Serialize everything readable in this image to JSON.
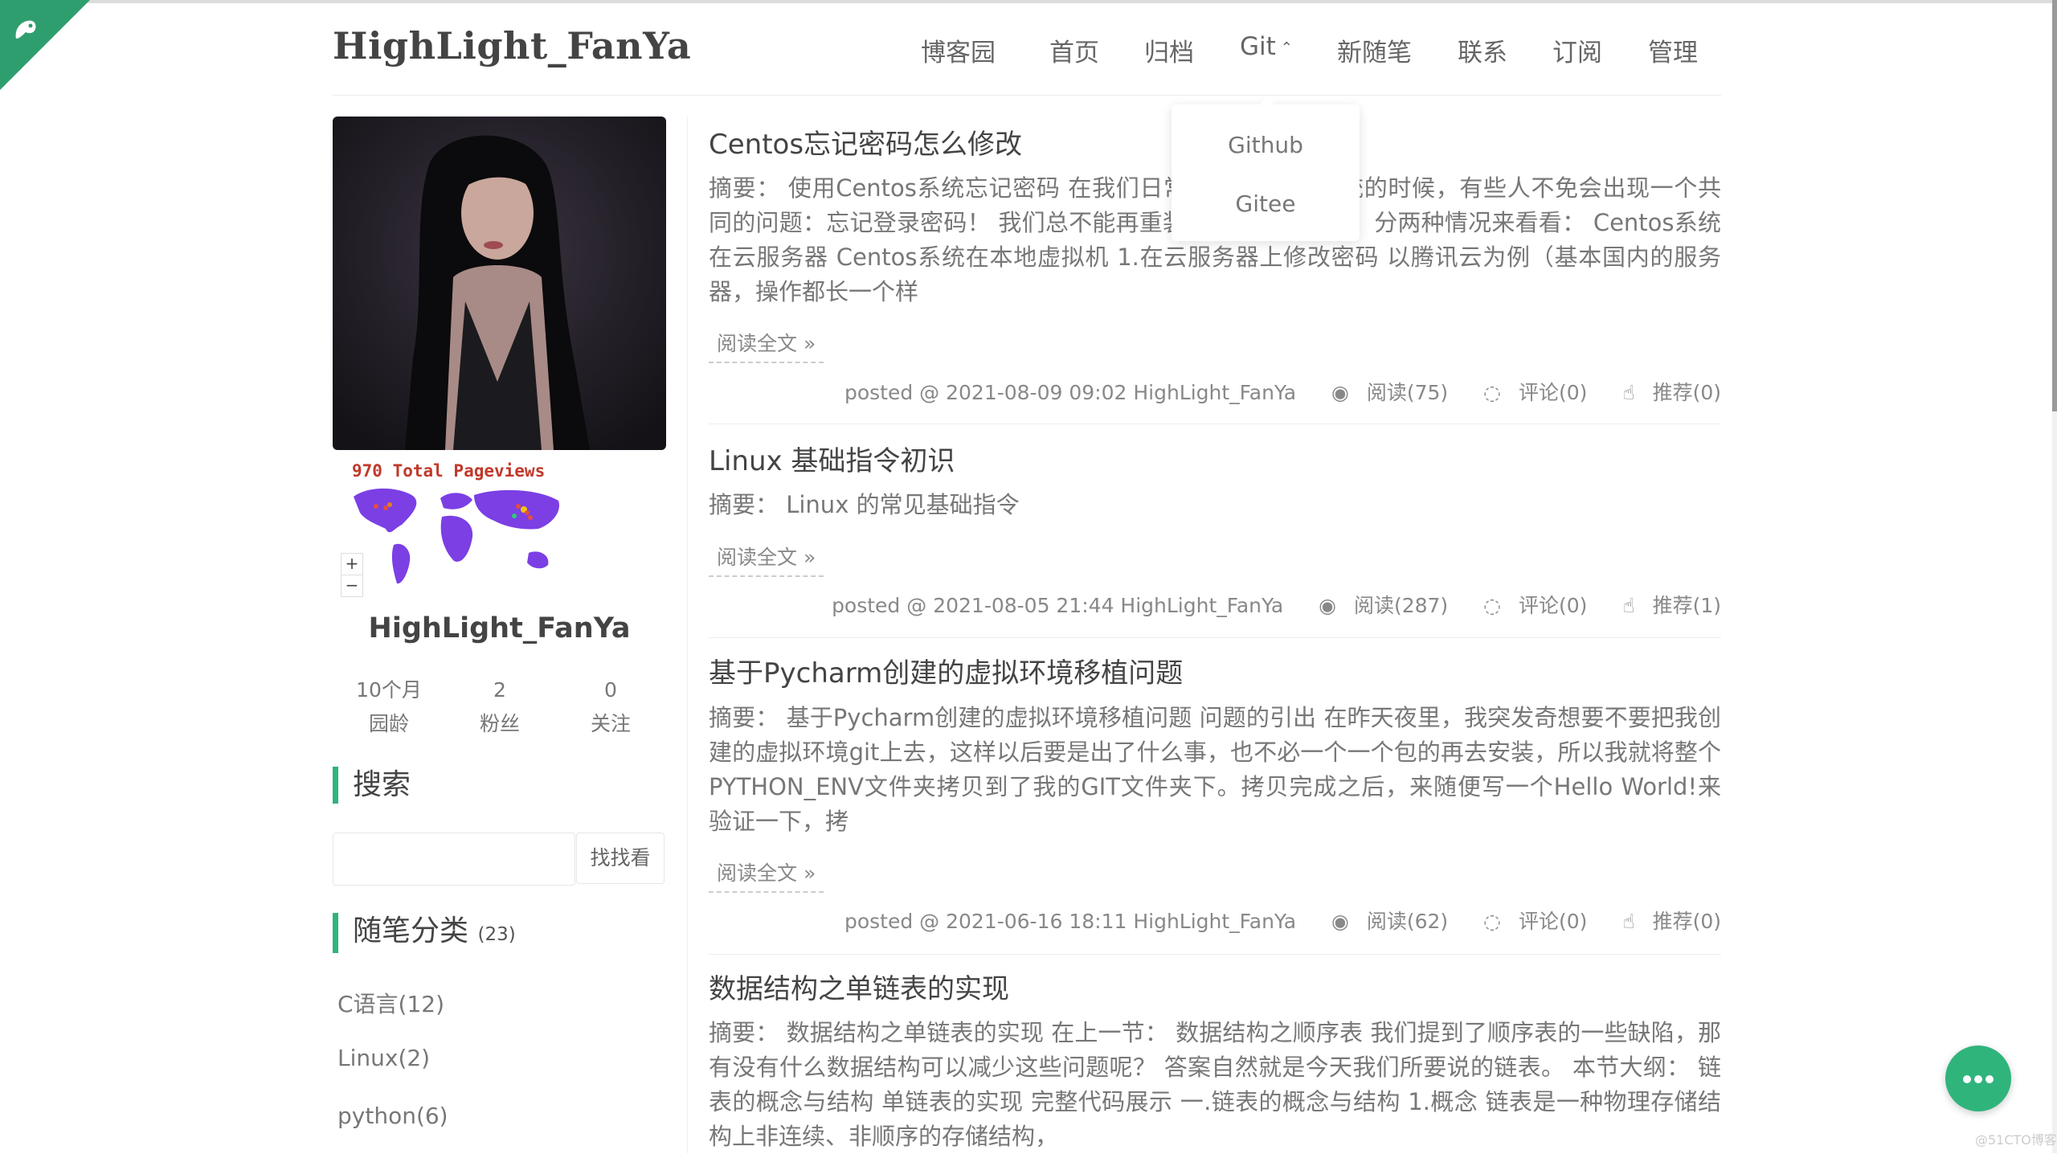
{
  "site": {
    "title": "HighLight_FanYa"
  },
  "nav": {
    "items": [
      "博客园",
      "首页",
      "归档",
      "Git",
      "新随笔",
      "联系",
      "订阅",
      "管理"
    ],
    "dropdown": [
      "Github",
      "Gitee"
    ]
  },
  "profile": {
    "pageviews": "970 Total Pageviews",
    "map_zoom_in": "+",
    "map_zoom_out": "−",
    "name": "HighLight_FanYa",
    "stats": [
      {
        "value": "10个月",
        "label": "园龄"
      },
      {
        "value": "2",
        "label": "粉丝"
      },
      {
        "value": "0",
        "label": "关注"
      }
    ]
  },
  "search": {
    "heading": "搜索",
    "button": "找找看",
    "placeholder": ""
  },
  "categories": {
    "heading": "随笔分类",
    "count": "(23)",
    "items": [
      "C语言(12)",
      "Linux(2)",
      "python(6)"
    ]
  },
  "posts": [
    {
      "title": "Centos忘记密码怎么修改",
      "summary": "摘要： 使用Centos系统忘记密码 在我们日常使用Centos系统的时候，有些人不免会出现一个共同的问题：忘记登录密码！ 我们总不能再重装一遍吧！不要慌，分两种情况来看看： Centos系统在云服务器 Centos系统在本地虚拟机 1.在云服务器上修改密码 以腾讯云为例（基本国内的服务器，操作都长一个样",
      "read_more": "阅读全文 »",
      "posted": "posted @ 2021-08-09 09:02 HighLight_FanYa",
      "views": "阅读(75)",
      "comments": "评论(0)",
      "likes": "推荐(0)"
    },
    {
      "title": "Linux 基础指令初识",
      "summary": "摘要： Linux 的常见基础指令",
      "read_more": "阅读全文 »",
      "posted": "posted @ 2021-08-05 21:44 HighLight_FanYa",
      "views": "阅读(287)",
      "comments": "评论(0)",
      "likes": "推荐(1)"
    },
    {
      "title": "基于Pycharm创建的虚拟环境移植问题",
      "summary": "摘要： 基于Pycharm创建的虚拟环境移植问题 问题的引出 在昨天夜里，我突发奇想要不要把我创建的虚拟环境git上去，这样以后要是出了什么事，也不必一个一个包的再去安装，所以我就将整个PYTHON_ENV文件夹拷贝到了我的GIT文件夹下。拷贝完成之后，来随便写一个Hello World!来验证一下，拷",
      "read_more": "阅读全文 »",
      "posted": "posted @ 2021-06-16 18:11 HighLight_FanYa",
      "views": "阅读(62)",
      "comments": "评论(0)",
      "likes": "推荐(0)"
    },
    {
      "title": "数据结构之单链表的实现",
      "summary": "摘要： 数据结构之单链表的实现 在上一节： 数据结构之顺序表 我们提到了顺序表的一些缺陷，那有没有什么数据结构可以减少这些问题呢？ 答案自然就是今天我们所要说的链表。 本节大纲： 链表的概念与结构 单链表的实现 完整代码展示 一.链表的概念与结构 1.概念 链表是一种物理存储结构上非连续、非顺序的存储结构，"
    }
  ],
  "colors": {
    "accent": "#2fb47c",
    "corner": "#2f9e6e",
    "map": "#7b3fe4"
  },
  "icons": [
    "corner-logo-icon",
    "eye-icon",
    "comment-icon",
    "thumbs-up-icon",
    "more-icon",
    "chevron-up-icon"
  ],
  "watermark": "@51CTO博客"
}
